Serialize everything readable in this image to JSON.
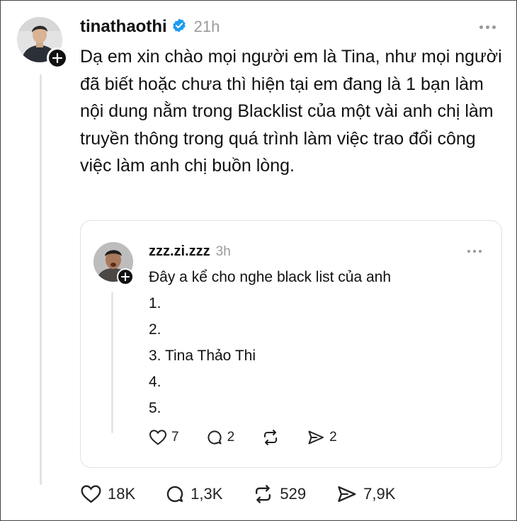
{
  "post": {
    "username": "tinathaothi",
    "time": "21h",
    "text": "Dạ em xin chào mọi người em là Tina, như mọi người đã biết hoặc chưa thì hiện tại em đang là 1 bạn làm nội dung nằm trong Blacklist của một vài anh chị làm truyền thông trong quá trình làm việc trao đổi công việc làm anh chị buồn lòng.",
    "likes": "18K",
    "comments": "1,3K",
    "reposts": "529",
    "shares": "7,9K",
    "verified": true
  },
  "quoted": {
    "username": "zzz.zi.zzz",
    "time": "3h",
    "lines": [
      "Đây a kể cho nghe black list của anh",
      "1.",
      "2.",
      "3. Tina Thảo Thi",
      "4.",
      "5."
    ],
    "likes": "7",
    "comments": "2",
    "shares": "2"
  },
  "colors": {
    "text": "#111111",
    "muted": "#9a9a9a",
    "verified": "#1d9bf0",
    "border": "#e2e2e2"
  }
}
